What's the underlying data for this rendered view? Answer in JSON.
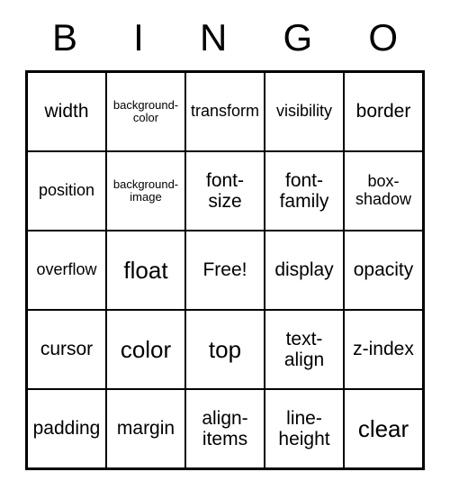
{
  "header": {
    "letters": [
      "B",
      "I",
      "N",
      "G",
      "O"
    ]
  },
  "grid": {
    "rows": [
      [
        {
          "text": "width",
          "size": "normal"
        },
        {
          "text": "background-color",
          "size": "small"
        },
        {
          "text": "transform",
          "size": "medium"
        },
        {
          "text": "visibility",
          "size": "medium"
        },
        {
          "text": "border",
          "size": "normal"
        }
      ],
      [
        {
          "text": "position",
          "size": "medium"
        },
        {
          "text": "background-image",
          "size": "small"
        },
        {
          "text": "font-size",
          "size": "normal"
        },
        {
          "text": "font-family",
          "size": "normal"
        },
        {
          "text": "box-shadow",
          "size": "medium"
        }
      ],
      [
        {
          "text": "overflow",
          "size": "medium"
        },
        {
          "text": "float",
          "size": "large"
        },
        {
          "text": "Free!",
          "size": "normal"
        },
        {
          "text": "display",
          "size": "normal"
        },
        {
          "text": "opacity",
          "size": "normal"
        }
      ],
      [
        {
          "text": "cursor",
          "size": "normal"
        },
        {
          "text": "color",
          "size": "large"
        },
        {
          "text": "top",
          "size": "large"
        },
        {
          "text": "text-align",
          "size": "normal"
        },
        {
          "text": "z-index",
          "size": "normal"
        }
      ],
      [
        {
          "text": "padding",
          "size": "normal"
        },
        {
          "text": "margin",
          "size": "normal"
        },
        {
          "text": "align-items",
          "size": "normal"
        },
        {
          "text": "line-height",
          "size": "normal"
        },
        {
          "text": "clear",
          "size": "large"
        }
      ]
    ]
  }
}
